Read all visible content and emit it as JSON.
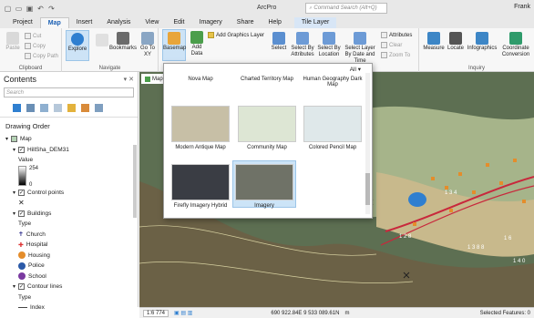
{
  "app": {
    "title": "ArcPro",
    "search_placeholder": "Command Search (Alt+Q)",
    "user": "Frank"
  },
  "tabs": [
    "Project",
    "Map",
    "Insert",
    "Analysis",
    "View",
    "Edit",
    "Imagery",
    "Share",
    "Help"
  ],
  "context_tab": "Tile Layer",
  "ribbon": {
    "clipboard": {
      "label": "Clipboard",
      "paste": "Paste",
      "cut": "Cut",
      "copy": "Copy",
      "copy_path": "Copy Path"
    },
    "navigate": {
      "label": "Navigate",
      "explore": "Explore",
      "bookmarks": "Bookmarks",
      "goto": "Go To XY"
    },
    "layer": {
      "basemap": "Basemap",
      "add_data": "Add Data",
      "add_graphics": "Add Graphics Layer"
    },
    "selection": {
      "select": "Select",
      "by_attr": "Select By Attributes",
      "by_loc": "Select By Location",
      "by_date": "Select Layer By Date and Time",
      "attributes": "Attributes",
      "clear": "Clear",
      "zoom_to": "Zoom To"
    },
    "inquiry": {
      "label": "Inquiry",
      "measure": "Measure",
      "locate": "Locate",
      "infographics": "Infographics",
      "coord": "Coordinate Conversion"
    }
  },
  "contents": {
    "title": "Contents",
    "search_placeholder": "Search",
    "drawing_order": "Drawing Order",
    "items": [
      {
        "label": "Map",
        "type": "map"
      },
      {
        "label": "HillSha_DEM31",
        "type": "layer"
      },
      {
        "label": "Value",
        "type": "sub"
      },
      {
        "label": "254",
        "type": "value"
      },
      {
        "label": "0",
        "type": "value"
      },
      {
        "label": "Control points",
        "type": "layer"
      },
      {
        "label": "Buildings",
        "type": "layer"
      },
      {
        "label": "Type",
        "type": "sub"
      },
      {
        "label": "Church",
        "type": "legend"
      },
      {
        "label": "Hospital",
        "type": "legend"
      },
      {
        "label": "Housing",
        "type": "legend"
      },
      {
        "label": "Police",
        "type": "legend"
      },
      {
        "label": "School",
        "type": "legend"
      },
      {
        "label": "Contour lines",
        "type": "layer"
      },
      {
        "label": "Type",
        "type": "sub"
      },
      {
        "label": "Index",
        "type": "legend"
      }
    ]
  },
  "gallery": {
    "filter": "All",
    "items": [
      {
        "label": "Nova Map",
        "color": "#2f3a4a"
      },
      {
        "label": "Charted Territory Map",
        "color": "#cbb99a"
      },
      {
        "label": "Human Geography Dark Map",
        "color": "#3a3a3a"
      },
      {
        "label": "Modern Antique Map",
        "color": "#c7bfa6"
      },
      {
        "label": "Community Map",
        "color": "#dde6d4"
      },
      {
        "label": "Colored Pencil Map",
        "color": "#dfe8ea"
      },
      {
        "label": "Firefly Imagery Hybrid",
        "color": "#3a3d44"
      },
      {
        "label": "Imagery",
        "color": "#6f7267"
      }
    ],
    "selected": "Imagery"
  },
  "map": {
    "tab": "Map",
    "labels": [
      "1 3 4",
      "1 2 8",
      "1 6",
      "1 3 8 8",
      "1 4 0"
    ]
  },
  "status": {
    "scale": "1:6 774",
    "coords": "690 922.84E 9 533 089.61N",
    "units": "m",
    "selected_features": "Selected Features: 0"
  }
}
